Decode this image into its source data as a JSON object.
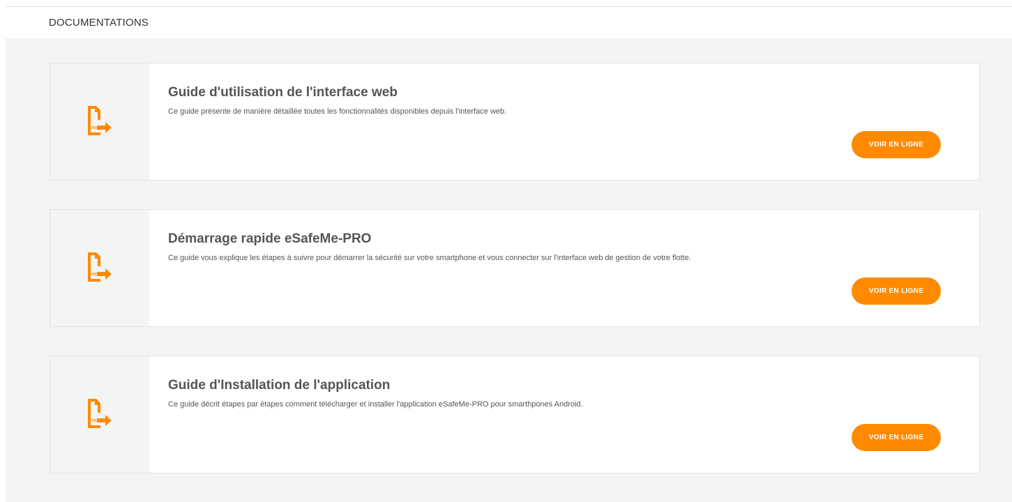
{
  "header": {
    "title": "DOCUMENTATIONS"
  },
  "colors": {
    "accent": "#ff8a00",
    "background": "#f4f4f4",
    "card": "#ffffff"
  },
  "documents": [
    {
      "icon": "pdf-export-icon",
      "icon_label": "PDF",
      "title": "Guide d'utilisation de l'interface web",
      "description": "Ce guide présente de manière détaillée toutes les fonctionnalités disponibles depuis l'interface web.",
      "button_label": "VOIR EN LIGNE"
    },
    {
      "icon": "pdf-export-icon",
      "icon_label": "PDF",
      "title": "Démarrage rapide eSafeMe-PRO",
      "description": "Ce guide vous explique les étapes à suivre pour démarrer la sécurité sur votre smartphone et vous connecter sur l'interface web de gestion de votre flotte.",
      "button_label": "VOIR EN LIGNE"
    },
    {
      "icon": "pdf-export-icon",
      "icon_label": "PDF",
      "title": "Guide d'Installation de l'application",
      "description": "Ce guide décrit étapes par étapes comment télécharger et installer l'application eSafeMe-PRO pour smarthpones Android.",
      "button_label": "VOIR EN LIGNE"
    }
  ]
}
